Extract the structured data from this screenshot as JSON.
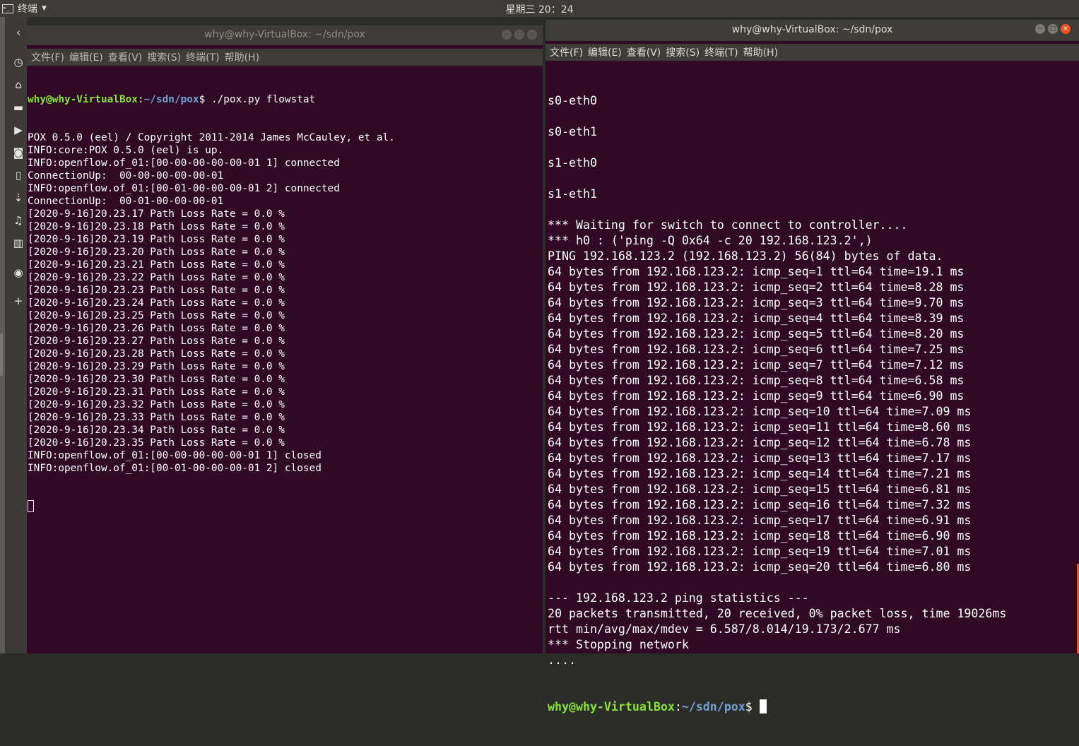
{
  "topbar": {
    "app_label": "终端",
    "clock": "星期三 20：24"
  },
  "launcher": {
    "items": [
      {
        "icon": "back-chevron-icon"
      },
      {
        "icon": "clock-icon"
      },
      {
        "icon": "home-icon"
      },
      {
        "icon": "folder-icon"
      },
      {
        "icon": "video-icon"
      },
      {
        "icon": "camera-icon"
      },
      {
        "icon": "document-icon"
      },
      {
        "icon": "download-icon"
      },
      {
        "icon": "music-icon"
      },
      {
        "icon": "trash-icon"
      },
      {
        "icon": "disc-icon"
      },
      {
        "icon": "add-icon"
      }
    ]
  },
  "left_window": {
    "title": "why@why-VirtualBox: ~/sdn/pox",
    "menu": [
      "文件(F)",
      "编辑(E)",
      "查看(V)",
      "搜索(S)",
      "终端(T)",
      "帮助(H)"
    ],
    "prompt_user": "why@why-VirtualBox",
    "prompt_path": "~/sdn/pox",
    "prompt_sep": ":",
    "prompt_end": "$ ",
    "command": "./pox.py flowstat",
    "lines": [
      "POX 0.5.0 (eel) / Copyright 2011-2014 James McCauley, et al.",
      "INFO:core:POX 0.5.0 (eel) is up.",
      "INFO:openflow.of_01:[00-00-00-00-00-01 1] connected",
      "ConnectionUp:  00-00-00-00-00-01",
      "INFO:openflow.of_01:[00-01-00-00-00-01 2] connected",
      "ConnectionUp:  00-01-00-00-00-01",
      "[2020-9-16]20.23.17 Path Loss Rate = 0.0 %",
      "[2020-9-16]20.23.18 Path Loss Rate = 0.0 %",
      "[2020-9-16]20.23.19 Path Loss Rate = 0.0 %",
      "[2020-9-16]20.23.20 Path Loss Rate = 0.0 %",
      "[2020-9-16]20.23.21 Path Loss Rate = 0.0 %",
      "[2020-9-16]20.23.22 Path Loss Rate = 0.0 %",
      "[2020-9-16]20.23.23 Path Loss Rate = 0.0 %",
      "[2020-9-16]20.23.24 Path Loss Rate = 0.0 %",
      "[2020-9-16]20.23.25 Path Loss Rate = 0.0 %",
      "[2020-9-16]20.23.26 Path Loss Rate = 0.0 %",
      "[2020-9-16]20.23.27 Path Loss Rate = 0.0 %",
      "[2020-9-16]20.23.28 Path Loss Rate = 0.0 %",
      "[2020-9-16]20.23.29 Path Loss Rate = 0.0 %",
      "[2020-9-16]20.23.30 Path Loss Rate = 0.0 %",
      "[2020-9-16]20.23.31 Path Loss Rate = 0.0 %",
      "[2020-9-16]20.23.32 Path Loss Rate = 0.0 %",
      "[2020-9-16]20.23.33 Path Loss Rate = 0.0 %",
      "[2020-9-16]20.23.34 Path Loss Rate = 0.0 %",
      "[2020-9-16]20.23.35 Path Loss Rate = 0.0 %",
      "INFO:openflow.of_01:[00-00-00-00-00-01 1] closed",
      "INFO:openflow.of_01:[00-01-00-00-00-01 2] closed"
    ]
  },
  "right_window": {
    "title": "why@why-VirtualBox: ~/sdn/pox",
    "menu": [
      "文件(F)",
      "编辑(E)",
      "查看(V)",
      "搜索(S)",
      "终端(T)",
      "帮助(H)"
    ],
    "lines": [
      "s0-eth0",
      "",
      "s0-eth1",
      "",
      "s1-eth0",
      "",
      "s1-eth1",
      "",
      "*** Waiting for switch to connect to controller....",
      "*** h0 : ('ping -Q 0x64 -c 20 192.168.123.2',)",
      "PING 192.168.123.2 (192.168.123.2) 56(84) bytes of data.",
      "64 bytes from 192.168.123.2: icmp_seq=1 ttl=64 time=19.1 ms",
      "64 bytes from 192.168.123.2: icmp_seq=2 ttl=64 time=8.28 ms",
      "64 bytes from 192.168.123.2: icmp_seq=3 ttl=64 time=9.70 ms",
      "64 bytes from 192.168.123.2: icmp_seq=4 ttl=64 time=8.39 ms",
      "64 bytes from 192.168.123.2: icmp_seq=5 ttl=64 time=8.20 ms",
      "64 bytes from 192.168.123.2: icmp_seq=6 ttl=64 time=7.25 ms",
      "64 bytes from 192.168.123.2: icmp_seq=7 ttl=64 time=7.12 ms",
      "64 bytes from 192.168.123.2: icmp_seq=8 ttl=64 time=6.58 ms",
      "64 bytes from 192.168.123.2: icmp_seq=9 ttl=64 time=6.90 ms",
      "64 bytes from 192.168.123.2: icmp_seq=10 ttl=64 time=7.09 ms",
      "64 bytes from 192.168.123.2: icmp_seq=11 ttl=64 time=8.60 ms",
      "64 bytes from 192.168.123.2: icmp_seq=12 ttl=64 time=6.78 ms",
      "64 bytes from 192.168.123.2: icmp_seq=13 ttl=64 time=7.17 ms",
      "64 bytes from 192.168.123.2: icmp_seq=14 ttl=64 time=7.21 ms",
      "64 bytes from 192.168.123.2: icmp_seq=15 ttl=64 time=6.81 ms",
      "64 bytes from 192.168.123.2: icmp_seq=16 ttl=64 time=7.32 ms",
      "64 bytes from 192.168.123.2: icmp_seq=17 ttl=64 time=6.91 ms",
      "64 bytes from 192.168.123.2: icmp_seq=18 ttl=64 time=6.90 ms",
      "64 bytes from 192.168.123.2: icmp_seq=19 ttl=64 time=7.01 ms",
      "64 bytes from 192.168.123.2: icmp_seq=20 ttl=64 time=6.80 ms",
      "",
      "--- 192.168.123.2 ping statistics ---",
      "20 packets transmitted, 20 received, 0% packet loss, time 19026ms",
      "rtt min/avg/max/mdev = 6.587/8.014/19.173/2.677 ms",
      "*** Stopping network",
      "...."
    ],
    "prompt_user": "why@why-VirtualBox",
    "prompt_path": "~/sdn/pox",
    "prompt_sep": ":",
    "prompt_end": "$ "
  },
  "colors": {
    "terminal_bg": "#300a24",
    "prompt_user": "#8ae234",
    "prompt_path": "#729fcf",
    "close_button": "#e95420"
  }
}
